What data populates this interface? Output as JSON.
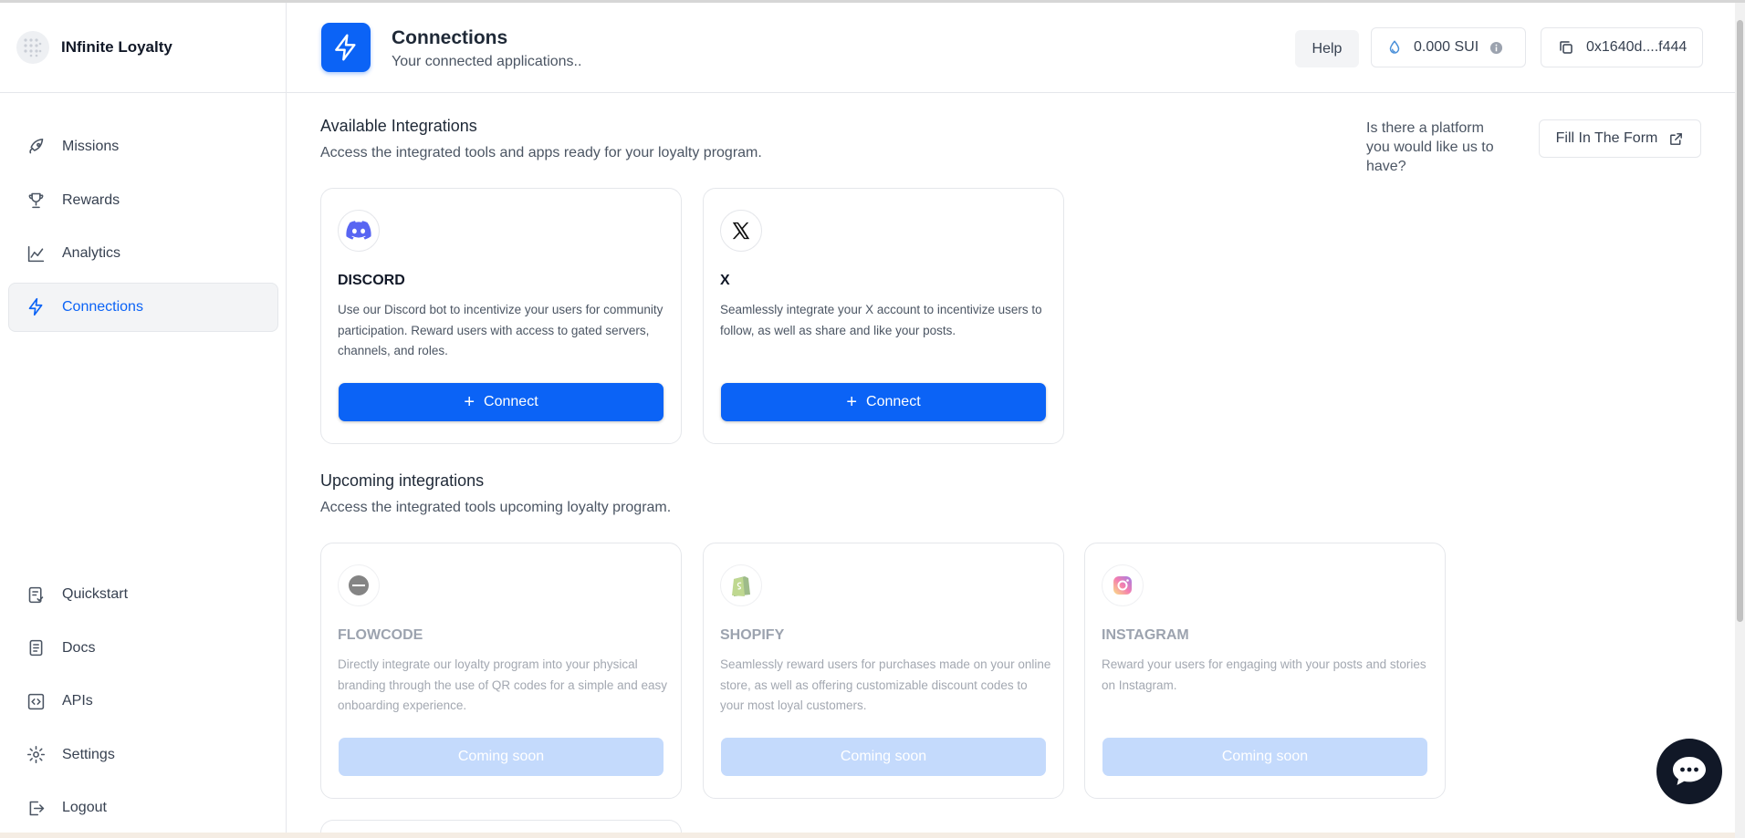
{
  "app": {
    "brand_name": "INfinite Loyalty"
  },
  "sidebar": {
    "top_items": [
      {
        "label": "Missions",
        "icon": "rocket-icon"
      },
      {
        "label": "Rewards",
        "icon": "trophy-icon"
      },
      {
        "label": "Analytics",
        "icon": "chart-line-icon"
      },
      {
        "label": "Connections",
        "icon": "lightning-icon",
        "active": true
      }
    ],
    "bottom_items": [
      {
        "label": "Quickstart",
        "icon": "checklist-icon"
      },
      {
        "label": "Docs",
        "icon": "document-icon"
      },
      {
        "label": "APIs",
        "icon": "code-icon"
      },
      {
        "label": "Settings",
        "icon": "gear-icon"
      },
      {
        "label": "Logout",
        "icon": "logout-icon"
      }
    ]
  },
  "header": {
    "title": "Connections",
    "subtitle": "Your connected applications..",
    "help_label": "Help",
    "balance": "0.000 SUI",
    "address": "0x1640d....f444"
  },
  "available": {
    "title": "Available Integrations",
    "subtitle": "Access the integrated tools and apps ready for your loyalty program.",
    "platform_question": "Is there a platform you would like us to have?",
    "form_button": "Fill In The Form",
    "cards": [
      {
        "title": "DISCORD",
        "description": "Use our Discord bot to incentivize your users for community participation. Reward users with access to gated servers, channels, and roles.",
        "button": "Connect",
        "icon": "discord-icon"
      },
      {
        "title": "X",
        "description": "Seamlessly integrate your X account to incentivize users to follow, as well as share and like your posts.",
        "button": "Connect",
        "icon": "x-logo-icon"
      }
    ]
  },
  "upcoming": {
    "title": "Upcoming integrations",
    "subtitle": "Access the integrated tools upcoming loyalty program.",
    "cards": [
      {
        "title": "FLOWCODE",
        "description": "Directly integrate our loyalty program into your physical branding through the use of QR codes for a simple and easy onboarding experience.",
        "button": "Coming soon",
        "icon": "flowcode-icon"
      },
      {
        "title": "SHOPIFY",
        "description": "Seamlessly reward users for purchases made on your online store, as well as offering customizable discount codes to your most loyal customers.",
        "button": "Coming soon",
        "icon": "shopify-icon"
      },
      {
        "title": "INSTAGRAM",
        "description": "Reward your users for engaging with your posts and stories on Instagram.",
        "button": "Coming soon",
        "icon": "instagram-icon"
      }
    ]
  },
  "colors": {
    "accent": "#0b63f6",
    "disabled_button": "#c4dafc"
  }
}
